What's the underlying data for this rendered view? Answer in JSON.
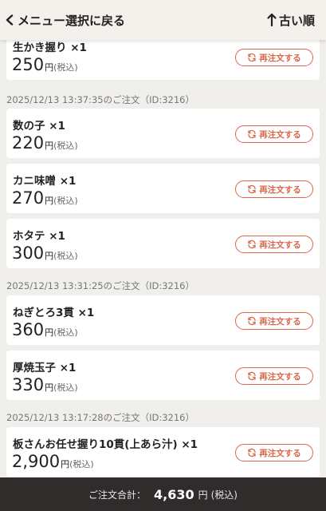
{
  "header": {
    "back_label": "メニュー選択に戻る",
    "sort_label": "古い順"
  },
  "orders": [
    {
      "heading": "",
      "items": [
        {
          "name": "生かき握り ×1",
          "price": "250",
          "yen": "円",
          "tax": "(税込)"
        }
      ]
    },
    {
      "heading": "2025/12/13 13:37:35のご注文（ID:3216）",
      "items": [
        {
          "name": "数の子 ×1",
          "price": "220",
          "yen": "円",
          "tax": "(税込)"
        },
        {
          "name": "カニ味噌 ×1",
          "price": "270",
          "yen": "円",
          "tax": "(税込)"
        },
        {
          "name": "ホタテ ×1",
          "price": "300",
          "yen": "円",
          "tax": "(税込)"
        }
      ]
    },
    {
      "heading": "2025/12/13 13:31:25のご注文（ID:3216）",
      "items": [
        {
          "name": "ねぎとろ3貫 ×1",
          "price": "360",
          "yen": "円",
          "tax": "(税込)"
        },
        {
          "name": "厚焼玉子 ×1",
          "price": "330",
          "yen": "円",
          "tax": "(税込)"
        }
      ]
    },
    {
      "heading": "2025/12/13 13:17:28のご注文（ID:3216）",
      "items": [
        {
          "name": "板さんお任せ握り10貫(上あら汁) ×1",
          "price": "2,900",
          "yen": "円",
          "tax": "(税込)"
        }
      ]
    }
  ],
  "reorder_label": "再注文する",
  "footer": {
    "label": "ご注文合計：",
    "amount": "4,630",
    "unit": "円",
    "tax": "(税込)"
  },
  "colors": {
    "accent": "#d9674a",
    "footer_bg": "#2f2c2b",
    "page_bg": "#f1efec"
  }
}
